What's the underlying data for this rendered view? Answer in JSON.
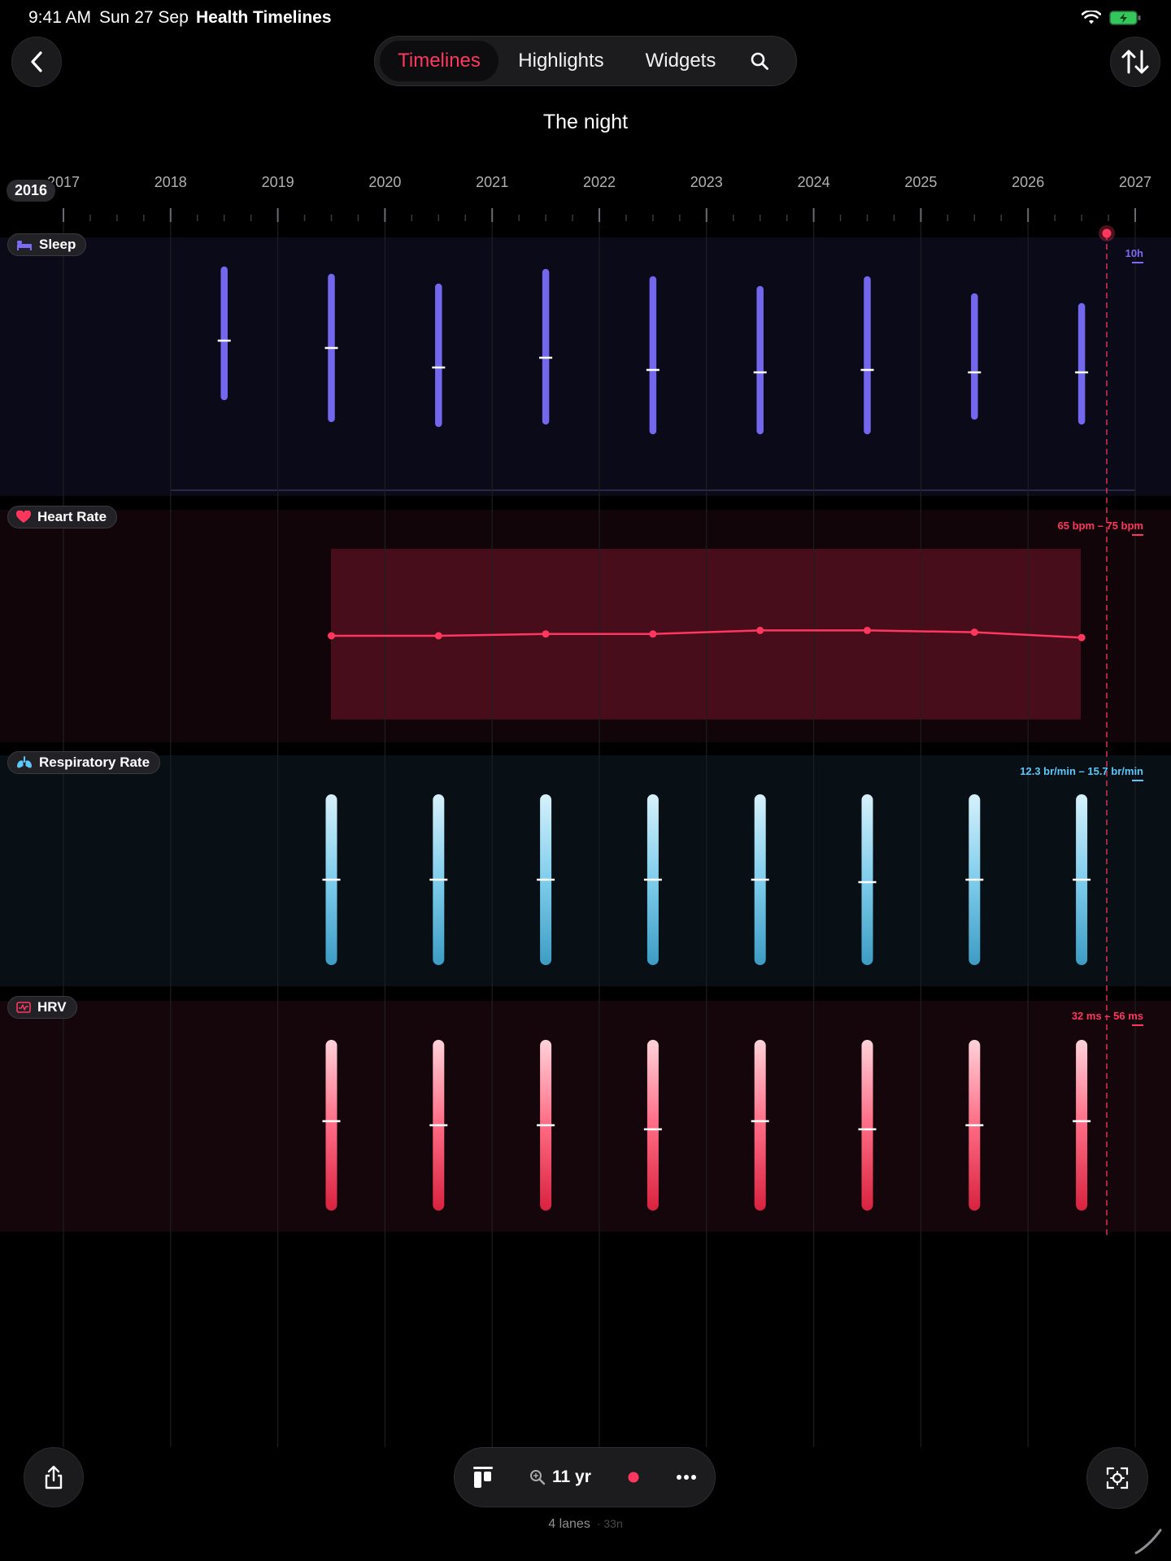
{
  "status": {
    "time": "9:41 AM",
    "date": "Sun 27 Sep",
    "app": "Health Timelines"
  },
  "nav": {
    "tabs": [
      "Timelines",
      "Highlights",
      "Widgets"
    ],
    "active": "Timelines"
  },
  "page": {
    "title": "The night"
  },
  "axis": {
    "current_year_pill": "2016",
    "years": [
      "2017",
      "2018",
      "2019",
      "2020",
      "2021",
      "2022",
      "2023",
      "2024",
      "2025",
      "2026",
      "2027"
    ]
  },
  "lanes": {
    "sleep": {
      "label": "Sleep",
      "range": "10h",
      "color": "#7b6cf6"
    },
    "heart": {
      "label": "Heart Rate",
      "range": "65 bpm – 75 bpm",
      "color": "#ff375f"
    },
    "resp": {
      "label": "Respiratory Rate",
      "range": "12.3 br/min – 15.7 br/min",
      "color": "#5ac8fa"
    },
    "hrv": {
      "label": "HRV",
      "range": "32 ms – 56 ms",
      "color": "#ff375f"
    }
  },
  "toolbar": {
    "zoom_label": "11 yr"
  },
  "footer": {
    "lanes": "4 lanes",
    "sub": "· 33n"
  },
  "chart_data": [
    {
      "type": "range-bar",
      "lane": "Sleep",
      "x": [
        2018.5,
        2019.5,
        2020.5,
        2021.5,
        2022.5,
        2023.5,
        2024.5,
        2025.5,
        2026.5
      ],
      "low": [
        3.8,
        2.9,
        2.7,
        2.8,
        2.4,
        2.4,
        2.4,
        3.0,
        2.8
      ],
      "high": [
        9.0,
        8.7,
        8.3,
        8.9,
        8.6,
        8.2,
        8.6,
        7.9,
        7.5
      ],
      "median": [
        6.1,
        5.8,
        5.0,
        5.4,
        4.9,
        4.8,
        4.9,
        4.8,
        4.8
      ]
    },
    {
      "type": "line",
      "lane": "Heart Rate",
      "x": [
        2019.5,
        2020.5,
        2021.5,
        2022.5,
        2023.5,
        2024.5,
        2025.5,
        2026.5
      ],
      "values": [
        69.0,
        69.0,
        69.1,
        69.1,
        69.3,
        69.3,
        69.2,
        68.9
      ]
    },
    {
      "type": "range-bar",
      "lane": "Respiratory Rate",
      "x": [
        2019.5,
        2020.5,
        2021.5,
        2022.5,
        2023.5,
        2024.5,
        2025.5,
        2026.5
      ],
      "median": [
        14.0,
        14.0,
        14.0,
        14.0,
        14.0,
        13.9,
        14.0,
        14.0
      ]
    },
    {
      "type": "range-bar",
      "lane": "HRV",
      "x": [
        2019.5,
        2020.5,
        2021.5,
        2022.5,
        2023.5,
        2024.5,
        2025.5,
        2026.5
      ],
      "median": [
        45,
        44,
        44,
        43,
        45,
        43,
        44,
        45
      ]
    }
  ]
}
